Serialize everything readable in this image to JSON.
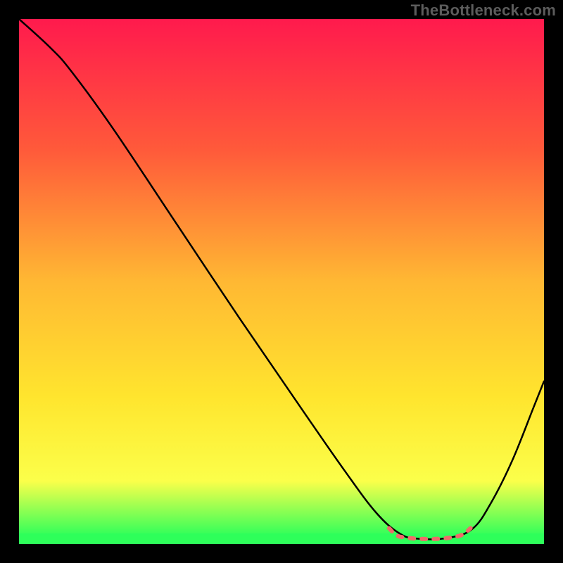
{
  "watermark": "TheBottleneck.com",
  "chart_data": {
    "type": "line",
    "title": "",
    "xlabel": "",
    "ylabel": "",
    "xlim": [
      0,
      100
    ],
    "ylim": [
      0,
      100
    ],
    "grid": false,
    "legend": "none",
    "annotations": [],
    "background_gradient_stops": [
      {
        "offset": 0.0,
        "color": "#ff1a4d"
      },
      {
        "offset": 0.25,
        "color": "#ff5a3a"
      },
      {
        "offset": 0.5,
        "color": "#ffb833"
      },
      {
        "offset": 0.72,
        "color": "#ffe52e"
      },
      {
        "offset": 0.88,
        "color": "#fbff4a"
      },
      {
        "offset": 0.985,
        "color": "#2eff5a"
      },
      {
        "offset": 1.0,
        "color": "#2eff5a"
      }
    ],
    "green_band": {
      "y0": 0,
      "y1": 2,
      "color": "#2eff5a"
    },
    "series": [
      {
        "name": "bottleneck-curve",
        "stroke": "#000000",
        "stroke_width": 2.5,
        "points": [
          {
            "x": 0.0,
            "y": 100.0
          },
          {
            "x": 6.0,
            "y": 94.5
          },
          {
            "x": 10.0,
            "y": 90.0
          },
          {
            "x": 18.0,
            "y": 79.0
          },
          {
            "x": 30.0,
            "y": 61.0
          },
          {
            "x": 42.0,
            "y": 43.0
          },
          {
            "x": 54.0,
            "y": 25.5
          },
          {
            "x": 62.0,
            "y": 14.0
          },
          {
            "x": 68.0,
            "y": 6.0
          },
          {
            "x": 72.5,
            "y": 2.0
          },
          {
            "x": 76.0,
            "y": 1.0
          },
          {
            "x": 82.0,
            "y": 1.2
          },
          {
            "x": 86.5,
            "y": 3.0
          },
          {
            "x": 90.0,
            "y": 8.0
          },
          {
            "x": 94.0,
            "y": 16.0
          },
          {
            "x": 98.0,
            "y": 26.0
          },
          {
            "x": 100.0,
            "y": 31.0
          }
        ]
      },
      {
        "name": "valley-segment",
        "stroke": "#f06a6a",
        "stroke_width": 6,
        "points": [
          {
            "x": 70.5,
            "y": 3.0
          },
          {
            "x": 72.0,
            "y": 1.6
          },
          {
            "x": 74.0,
            "y": 1.2
          },
          {
            "x": 76.0,
            "y": 1.0
          },
          {
            "x": 80.0,
            "y": 1.0
          },
          {
            "x": 84.0,
            "y": 1.6
          },
          {
            "x": 86.0,
            "y": 3.0
          }
        ]
      }
    ]
  }
}
